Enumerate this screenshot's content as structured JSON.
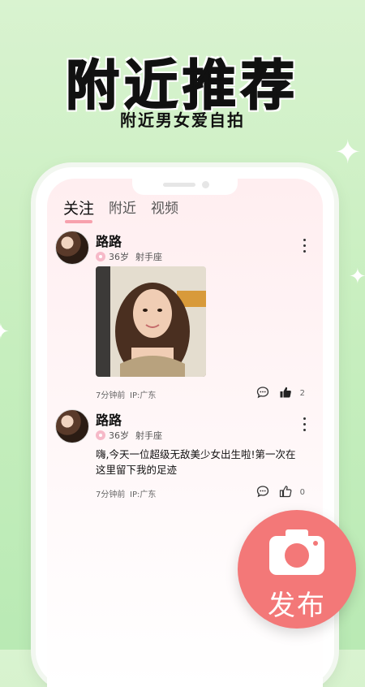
{
  "promo": {
    "headline": "附近推荐",
    "subline": "附近男女爱自拍"
  },
  "tabs": [
    {
      "label": "关注"
    },
    {
      "label": "附近"
    },
    {
      "label": "视频"
    }
  ],
  "posts": [
    {
      "name": "路路",
      "age": "36岁",
      "zodiac": "射手座",
      "time": "7分钟前",
      "ip": "IP:广东",
      "likes": "2"
    },
    {
      "name": "路路",
      "age": "36岁",
      "zodiac": "射手座",
      "text": "嗨,今天一位超级无敌美少女出生啦!第一次在这里留下我的足迹",
      "time": "7分钟前",
      "ip": "IP:广东",
      "likes": "0"
    }
  ],
  "publish": {
    "label": "发布"
  },
  "colors": {
    "accent": "#f37878",
    "tab_underline": "#f7a1ad",
    "background": "#c9efc0"
  }
}
